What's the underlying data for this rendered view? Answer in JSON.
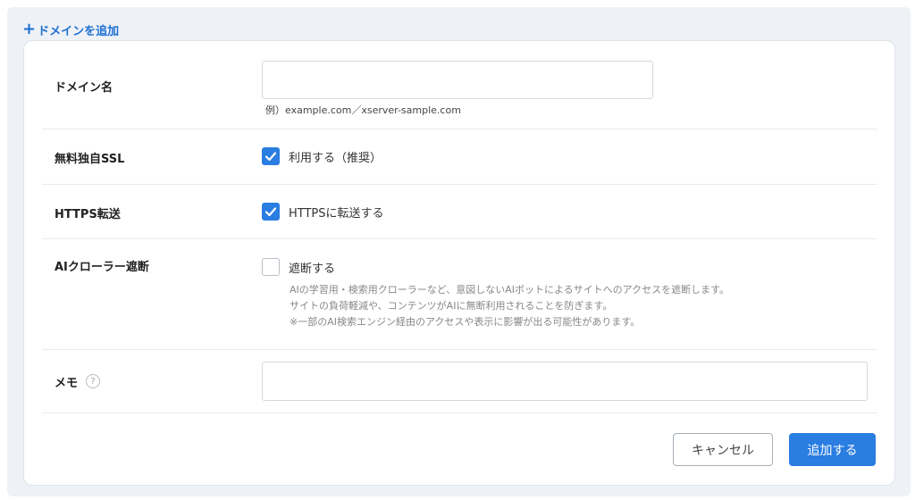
{
  "header": {
    "add_link_label": "ドメインを追加"
  },
  "form": {
    "domain": {
      "label": "ドメイン名",
      "value": "",
      "placeholder": "",
      "hint": "例）example.com／xserver-sample.com"
    },
    "ssl": {
      "label": "無料独自SSL",
      "checkbox_label": "利用する（推奨）",
      "checked": true
    },
    "https": {
      "label": "HTTPS転送",
      "checkbox_label": "HTTPSに転送する",
      "checked": true
    },
    "ai_crawler": {
      "label": "AIクローラー遮断",
      "checkbox_label": "遮断する",
      "checked": false,
      "description_lines": [
        "AIの学習用・検索用クローラーなど、意図しないAIボットによるサイトへのアクセスを遮断します。",
        "サイトの負荷軽減や、コンテンツがAIに無断利用されることを防ぎます。",
        "※一部のAI検索エンジン経由のアクセスや表示に影響が出る可能性があります。"
      ]
    },
    "memo": {
      "label": "メモ",
      "help_icon": "question-circle-icon",
      "value": "",
      "placeholder": ""
    }
  },
  "buttons": {
    "cancel": "キャンセル",
    "submit": "追加する"
  },
  "colors": {
    "accent": "#2a7de1",
    "link": "#1f6fd1",
    "background": "#eef2f7"
  }
}
